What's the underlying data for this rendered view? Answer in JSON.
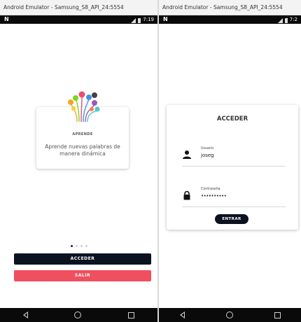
{
  "left": {
    "window_title": "Android Emulator - Samsung_S8_API_24:5554",
    "status_time": "7:19",
    "card": {
      "title": "APRENDE",
      "text": "Aprende nuevas palabras de manera dinámica"
    },
    "page_indicator": {
      "total": 4,
      "active_index": 0
    },
    "buttons": {
      "acceder": "ACCEDER",
      "salir": "SALIR"
    }
  },
  "right": {
    "window_title": "Android Emulator - Samsung_S8_API_24:5554",
    "status_time": "7:2",
    "login": {
      "title": "ACCEDER",
      "user_label": "Usuario",
      "user_value": "joseg",
      "pass_label": "Contraseña",
      "pass_value": "••••••••••",
      "submit": "ENTRAR"
    }
  },
  "nav": {
    "icons": [
      "back-icon",
      "home-icon",
      "recent-apps-icon"
    ]
  },
  "colors": {
    "primary": "#0b1220",
    "danger": "#ef4f5f",
    "status_bar": "#0a0a0a"
  }
}
